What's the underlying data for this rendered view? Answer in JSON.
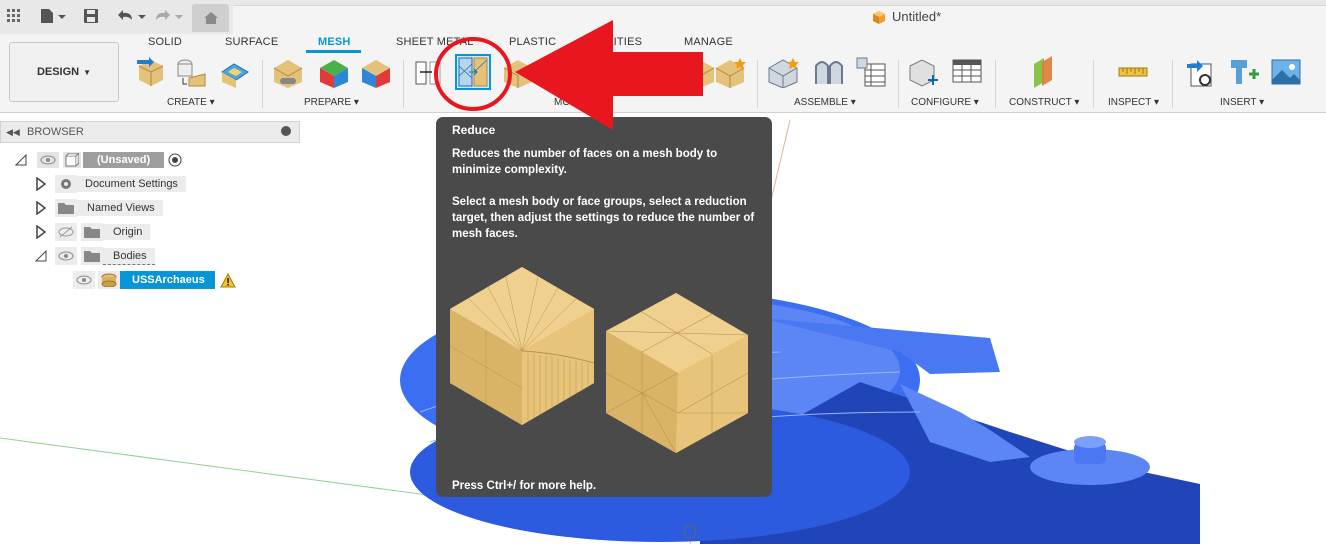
{
  "window": {
    "title": "Untitled*"
  },
  "workspace": {
    "label": "DESIGN"
  },
  "tabs": [
    {
      "label": "SOLID",
      "active": false
    },
    {
      "label": "SURFACE",
      "active": false
    },
    {
      "label": "MESH",
      "active": true
    },
    {
      "label": "SHEET METAL",
      "active": false
    },
    {
      "label": "PLASTIC",
      "active": false
    },
    {
      "label": "UTILITIES",
      "active": false
    },
    {
      "label": "MANAGE",
      "active": false
    }
  ],
  "groups": {
    "create": "CREATE ▾",
    "prepare": "PREPARE ▾",
    "modify": "MODIFY ▾",
    "assemble": "ASSEMBLE ▾",
    "configure": "CONFIGURE ▾",
    "construct": "CONSTRUCT ▾",
    "inspect": "INSPECT ▾",
    "insert": "INSERT ▾"
  },
  "browser": {
    "title": "BROWSER",
    "root": "(Unsaved)",
    "items": [
      {
        "label": "Document Settings"
      },
      {
        "label": "Named Views"
      },
      {
        "label": "Origin"
      },
      {
        "label": "Bodies"
      }
    ],
    "body": "USSArchaeus"
  },
  "tooltip": {
    "title": "Reduce",
    "para1": "Reduces the number of faces on a mesh body to minimize complexity.",
    "para2": "Select a mesh body or face groups, select a reduction target, then adjust the settings to reduce the number of mesh faces.",
    "footer": "Press Ctrl+/ for more help."
  },
  "colors": {
    "accent": "#0696d7",
    "selection": "#0696d7",
    "tooltip_bg": "#4a4a4a",
    "mesh_blue": "#3b6ef0",
    "mesh_dark": "#1f45b8",
    "arrow_red": "#e8161e",
    "cube_tan": "#e4c27a"
  }
}
